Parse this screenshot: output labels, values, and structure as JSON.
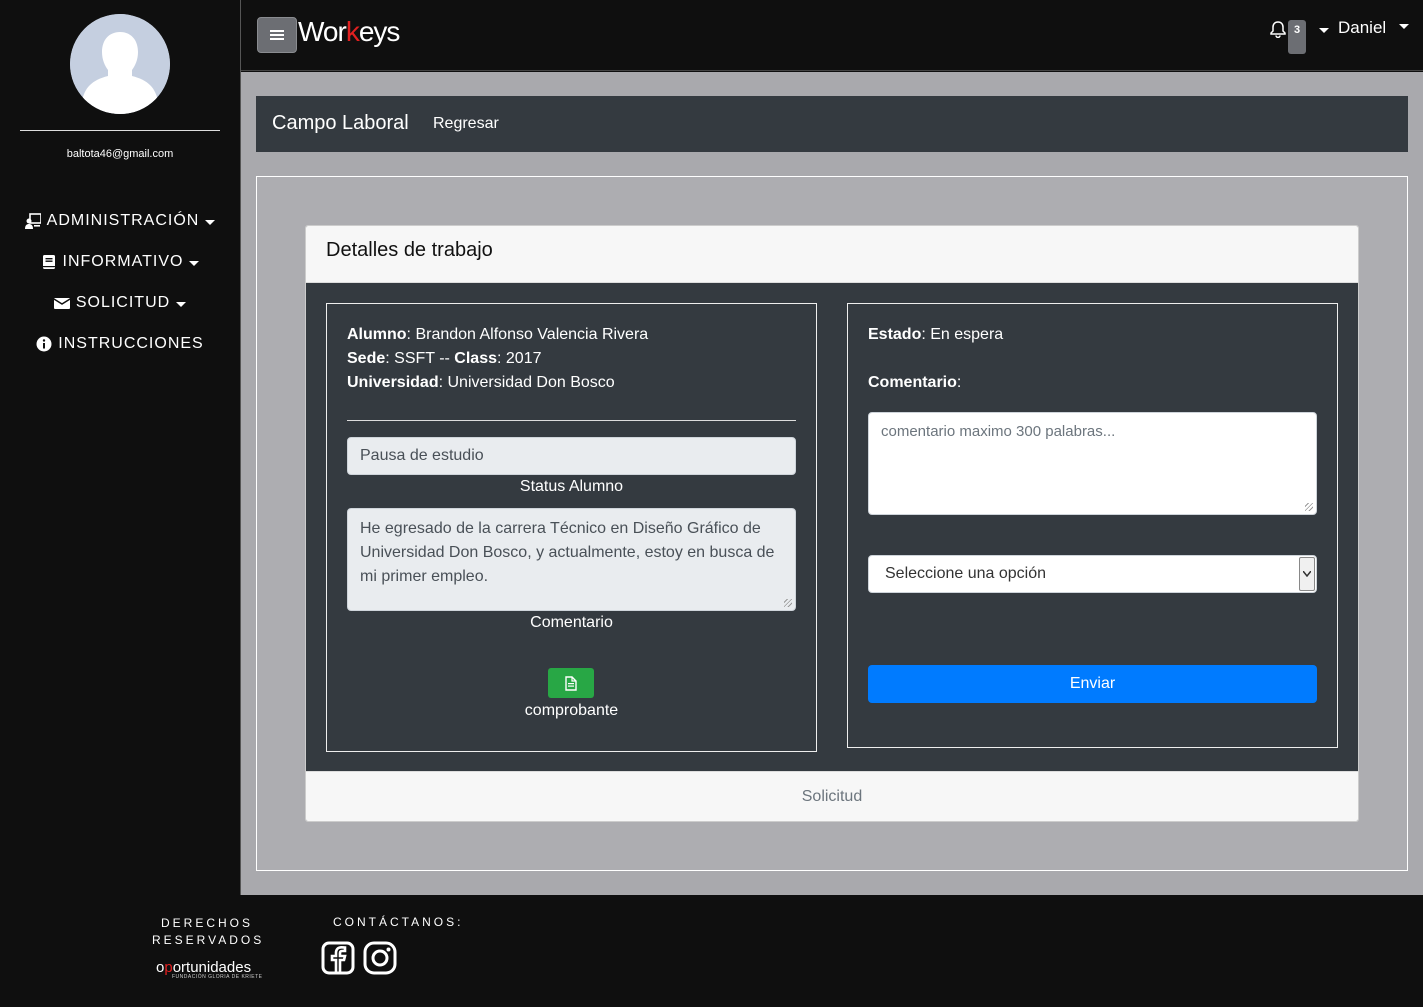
{
  "sidebar": {
    "email": "baltota46@gmail.com",
    "items": [
      {
        "label": "ADMINISTRACIÓN",
        "icon": "user-desk-icon",
        "dropdown": true
      },
      {
        "label": "INFORMATIVO",
        "icon": "book-icon",
        "dropdown": true
      },
      {
        "label": "SOLICITUD",
        "icon": "envelope-icon",
        "dropdown": true
      },
      {
        "label": "INSTRUCCIONES",
        "icon": "info-circle-icon",
        "dropdown": false
      }
    ]
  },
  "topbar": {
    "brand_part1": "Wor",
    "brand_part2": "k",
    "brand_part3": "eys",
    "notification_count": "3",
    "user_name": "Daniel"
  },
  "header": {
    "title": "Campo Laboral",
    "back_link": "Regresar"
  },
  "card": {
    "title": "Detalles de trabajo",
    "footer": "Solicitud",
    "left": {
      "alumno_label": "Alumno",
      "alumno_value": ": Brandon Alfonso Valencia Rivera",
      "sede_label": "Sede",
      "sede_value": ": SSFT -- ",
      "class_label": "Class",
      "class_value": ": 2017",
      "universidad_label": "Universidad",
      "universidad_value": ": Universidad Don Bosco",
      "status_value": "Pausa de estudio",
      "status_label": "Status Alumno",
      "comentario_value": "He egresado de la carrera Técnico en Diseño Gráfico de Universidad Don Bosco, y actualmente, estoy en busca de mi primer empleo.",
      "comentario_label": "Comentario",
      "doc_label": "comprobante"
    },
    "right": {
      "estado_label": "Estado",
      "estado_value": ": En espera",
      "comentario_label": "Comentario",
      "comentario_suffix": ":",
      "comentario_placeholder": "comentario maximo 300 palabras...",
      "select_value": "Seleccione una opción",
      "send_label": "Enviar"
    }
  },
  "footer": {
    "rights_line1": "DERECHOS",
    "rights_line2": "RESERVADOS",
    "logo_a": "o",
    "logo_b": "p",
    "logo_c": "ortunidades",
    "logo_sub": "FUNDACIÓN GLORIA DE KRIETE",
    "contact": "CONTÁCTANOS:"
  },
  "colors": {
    "primary": "#007bff",
    "success": "#28a745",
    "dark": "#343a40",
    "brand_accent": "#e02020"
  }
}
